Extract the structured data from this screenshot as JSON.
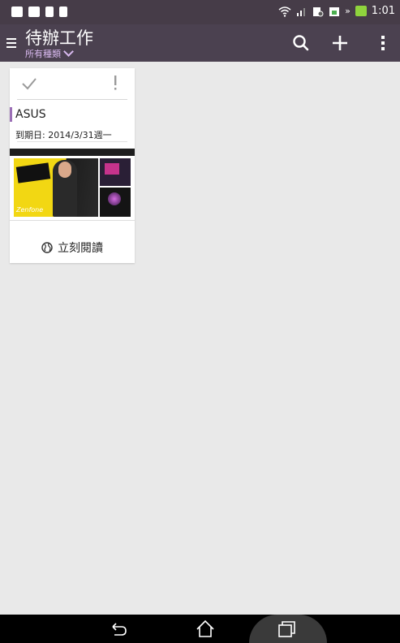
{
  "status_bar": {
    "time": "1:01",
    "icons": [
      "gallery-icon",
      "camera-icon",
      "sim-icon",
      "file-icon",
      "wifi-icon",
      "signal-icon",
      "sync-icon",
      "calendar-icon",
      "battery-charging-icon"
    ]
  },
  "app_bar": {
    "title": "待辦工作",
    "filter_label": "所有種類",
    "actions": [
      "search-icon",
      "add-icon",
      "more-vert-icon"
    ]
  },
  "task_card": {
    "title": "ASUS",
    "due_date": "到期日: 2014/3/31週一",
    "read_now_label": "立刻閱讀",
    "thumbnail_brand": "Zenfone"
  },
  "nav_bar": {
    "buttons": [
      "back-icon",
      "home-icon",
      "recent-apps-icon"
    ]
  },
  "colors": {
    "status_bar": "#463c48",
    "app_bar": "#4b4150",
    "accent": "#9b6fb6",
    "background": "#e9e9e9"
  }
}
